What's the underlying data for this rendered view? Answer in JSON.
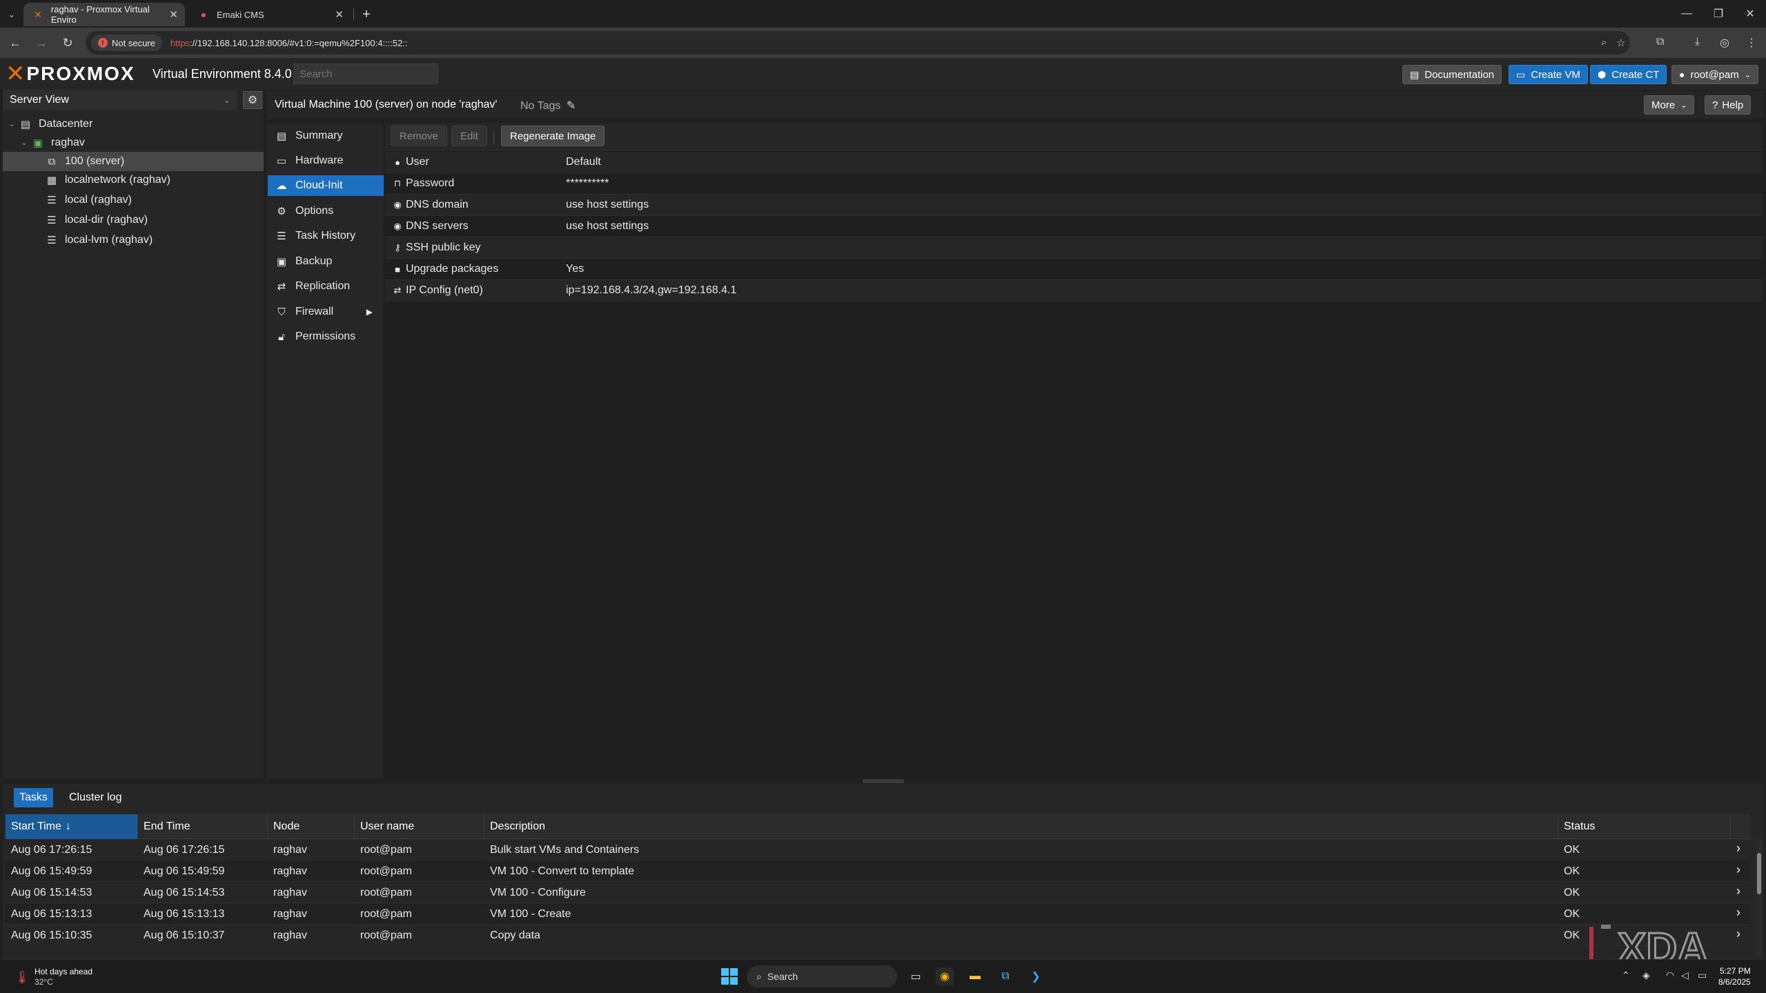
{
  "browser": {
    "tabs": [
      {
        "title": "raghav - Proxmox Virtual Enviro",
        "active": true
      },
      {
        "title": "Emaki CMS",
        "active": false
      }
    ],
    "not_secure_label": "Not secure",
    "url_scheme": "https",
    "url_rest": "://192.168.140.128:8006/#v1:0:=qemu%2F100:4::::52::"
  },
  "pve": {
    "brand": "PROXMOX",
    "version": "Virtual Environment 8.4.0",
    "search_placeholder": "Search",
    "header_buttons": {
      "documentation": "Documentation",
      "create_vm": "Create VM",
      "create_ct": "Create CT",
      "user": "root@pam"
    },
    "server_view": "Server View",
    "tree": [
      {
        "label": "Datacenter",
        "icon": "datacenter-icon"
      },
      {
        "label": "raghav",
        "icon": "node-icon"
      },
      {
        "label": "100 (server)",
        "icon": "vm-template-icon",
        "selected": true
      },
      {
        "label": "localnetwork (raghav)",
        "icon": "network-grid-icon"
      },
      {
        "label": "local (raghav)",
        "icon": "storage-icon"
      },
      {
        "label": "local-dir (raghav)",
        "icon": "storage-icon"
      },
      {
        "label": "local-lvm (raghav)",
        "icon": "storage-icon"
      }
    ],
    "content_title": "Virtual Machine 100 (server) on node 'raghav'",
    "no_tags": "No Tags",
    "more_label": "More",
    "help_label": "Help",
    "submenu": [
      {
        "label": "Summary",
        "icon": "book-icon"
      },
      {
        "label": "Hardware",
        "icon": "desktop-icon"
      },
      {
        "label": "Cloud-Init",
        "icon": "cloud-icon",
        "active": true
      },
      {
        "label": "Options",
        "icon": "gear-icon"
      },
      {
        "label": "Task History",
        "icon": "list-icon"
      },
      {
        "label": "Backup",
        "icon": "floppy-icon"
      },
      {
        "label": "Replication",
        "icon": "retweet-icon"
      },
      {
        "label": "Firewall",
        "icon": "shield-icon"
      },
      {
        "label": "Permissions",
        "icon": "unlock-icon"
      }
    ],
    "ci_toolbar": {
      "remove": "Remove",
      "edit": "Edit",
      "regenerate": "Regenerate Image"
    },
    "cloud_init": [
      {
        "key": "User",
        "value": "Default",
        "icon": "user-icon"
      },
      {
        "key": "Password",
        "value": "**********",
        "icon": "unlock-icon"
      },
      {
        "key": "DNS domain",
        "value": "use host settings",
        "icon": "globe-icon"
      },
      {
        "key": "DNS servers",
        "value": "use host settings",
        "icon": "globe-icon"
      },
      {
        "key": "SSH public key",
        "value": "",
        "icon": "key-icon"
      },
      {
        "key": "Upgrade packages",
        "value": "Yes",
        "icon": "square-icon"
      },
      {
        "key": "IP Config (net0)",
        "value": "ip=192.168.4.3/24,gw=192.168.4.1",
        "icon": "exchange-icon"
      }
    ],
    "tasks_tabs": {
      "tasks": "Tasks",
      "cluster_log": "Cluster log"
    },
    "task_columns": [
      "Start Time",
      "End Time",
      "Node",
      "User name",
      "Description",
      "Status"
    ],
    "tasks": [
      {
        "start": "Aug 06 17:26:15",
        "end": "Aug 06 17:26:15",
        "node": "raghav",
        "user": "root@pam",
        "desc": "Bulk start VMs and Containers",
        "status": "OK"
      },
      {
        "start": "Aug 06 15:49:59",
        "end": "Aug 06 15:49:59",
        "node": "raghav",
        "user": "root@pam",
        "desc": "VM 100 - Convert to template",
        "status": "OK"
      },
      {
        "start": "Aug 06 15:14:53",
        "end": "Aug 06 15:14:53",
        "node": "raghav",
        "user": "root@pam",
        "desc": "VM 100 - Configure",
        "status": "OK"
      },
      {
        "start": "Aug 06 15:13:13",
        "end": "Aug 06 15:13:13",
        "node": "raghav",
        "user": "root@pam",
        "desc": "VM 100 - Create",
        "status": "OK"
      },
      {
        "start": "Aug 06 15:10:35",
        "end": "Aug 06 15:10:37",
        "node": "raghav",
        "user": "root@pam",
        "desc": "Copy data",
        "status": "OK"
      }
    ]
  },
  "taskbar": {
    "weather_title": "Hot days ahead",
    "weather_temp": "32°C",
    "search_label": "Search",
    "time": "5:27 PM",
    "date": "8/6/2025"
  },
  "watermark": "XDA",
  "colors": {
    "accent_blue": "#1d6fbf",
    "proxmox_orange": "#e57000"
  }
}
